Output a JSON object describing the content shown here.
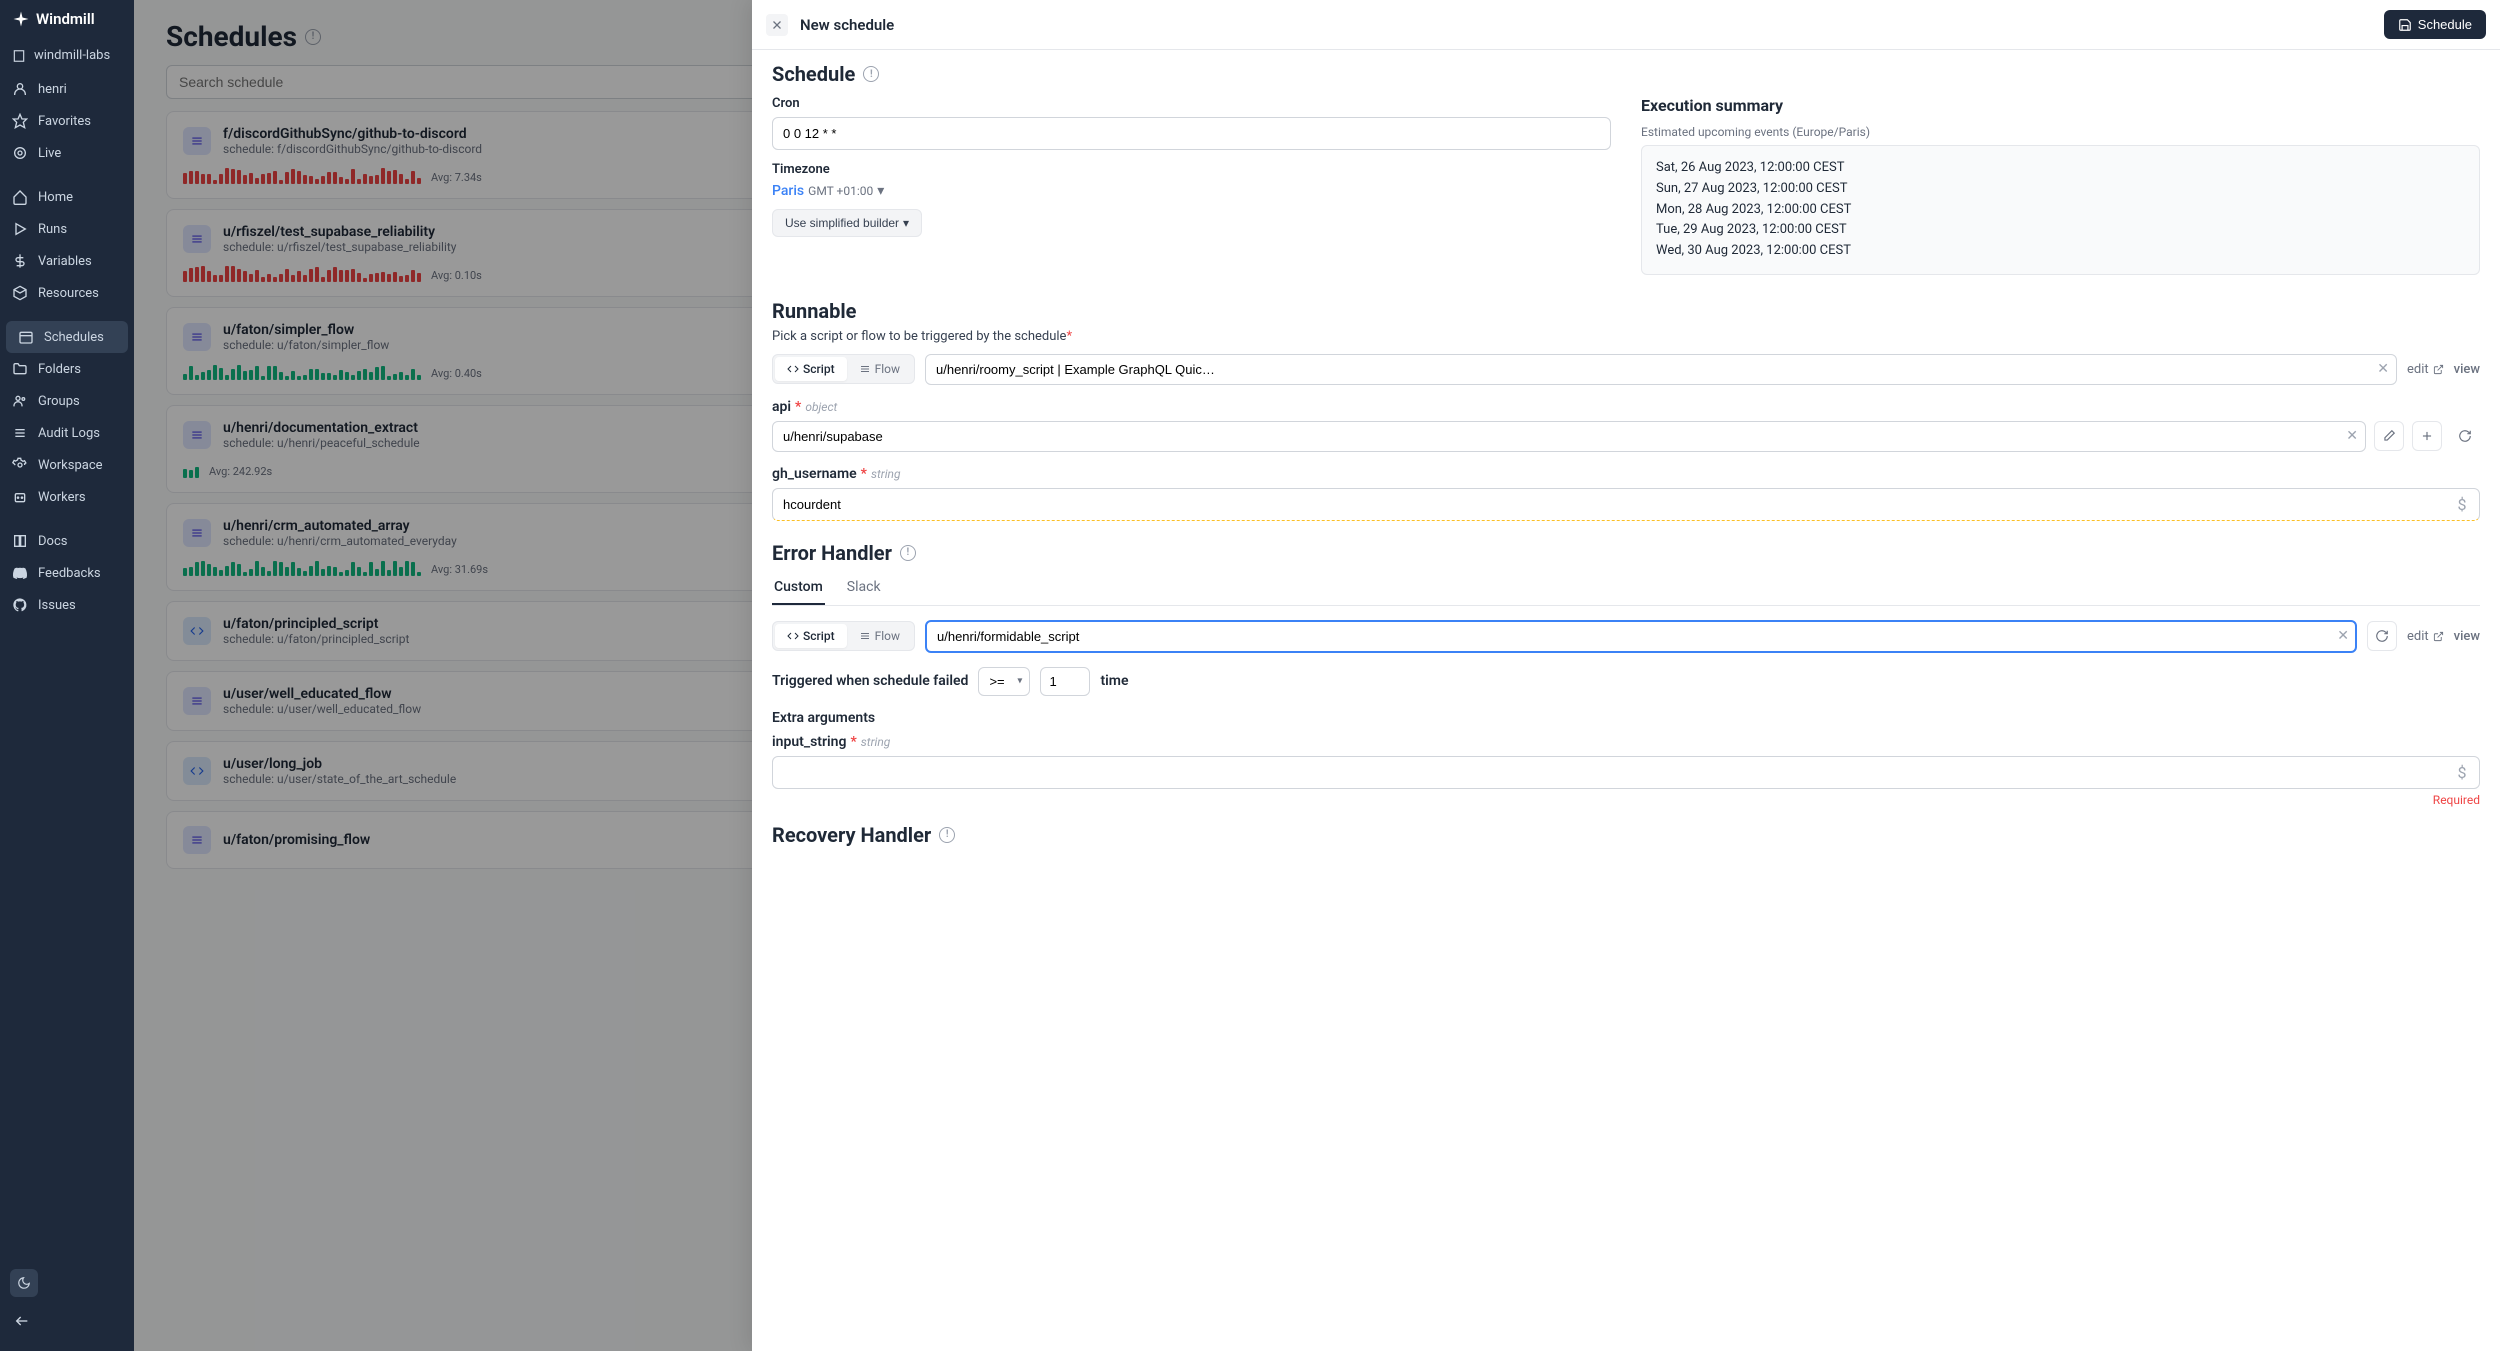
{
  "brand": "Windmill",
  "org": "windmill-labs",
  "user": "henri",
  "nav": {
    "favorites": "Favorites",
    "live": "Live",
    "home": "Home",
    "runs": "Runs",
    "variables": "Variables",
    "resources": "Resources",
    "schedules": "Schedules",
    "folders": "Folders",
    "groups": "Groups",
    "audit": "Audit Logs",
    "workspace": "Workspace",
    "workers": "Workers",
    "docs": "Docs",
    "feedbacks": "Feedbacks",
    "issues": "Issues"
  },
  "page": {
    "title": "Schedules",
    "search_placeholder": "Search schedule"
  },
  "schedules": [
    {
      "name": "f/discordGithubSync/github-to-discord",
      "sub": "schedule: f/discordGithubSync/github-to-discord",
      "avg": "Avg: 7.34s",
      "type": "flow",
      "bars": "red"
    },
    {
      "name": "u/rfiszel/test_supabase_reliability",
      "sub": "schedule: u/rfiszel/test_supabase_reliability",
      "avg": "Avg: 0.10s",
      "type": "flow",
      "bars": "red"
    },
    {
      "name": "u/faton/simpler_flow",
      "sub": "schedule: u/faton/simpler_flow",
      "avg": "Avg: 0.40s",
      "type": "flow",
      "bars": "green"
    },
    {
      "name": "u/henri/documentation_extract",
      "sub": "schedule: u/henri/peaceful_schedule",
      "avg": "Avg: 242.92s",
      "type": "flow",
      "bars": "green-short"
    },
    {
      "name": "u/henri/crm_automated_array",
      "sub": "schedule: u/henri/crm_automated_everyday",
      "avg": "Avg: 31.69s",
      "type": "flow",
      "bars": "green"
    },
    {
      "name": "u/faton/principled_script",
      "sub": "schedule: u/faton/principled_script",
      "avg": "",
      "type": "script",
      "bars": ""
    },
    {
      "name": "u/user/well_educated_flow",
      "sub": "schedule: u/user/well_educated_flow",
      "avg": "",
      "type": "flow",
      "bars": ""
    },
    {
      "name": "u/user/long_job",
      "sub": "schedule: u/user/state_of_the_art_schedule",
      "avg": "",
      "type": "script",
      "bars": ""
    },
    {
      "name": "u/faton/promising_flow",
      "sub": "",
      "avg": "",
      "type": "flow",
      "bars": ""
    }
  ],
  "drawer": {
    "title": "New schedule",
    "save_btn": "Schedule",
    "section_schedule": "Schedule",
    "cron_label": "Cron",
    "cron_value": "0 0 12 * *",
    "timezone_label": "Timezone",
    "timezone_city": "Paris",
    "timezone_offset": "GMT +01:00",
    "builder": "Use simplified builder",
    "exec_summary": "Execution summary",
    "events_label": "Estimated upcoming events (Europe/Paris)",
    "events": [
      "Sat, 26 Aug 2023, 12:00:00 CEST",
      "Sun, 27 Aug 2023, 12:00:00 CEST",
      "Mon, 28 Aug 2023, 12:00:00 CEST",
      "Tue, 29 Aug 2023, 12:00:00 CEST",
      "Wed, 30 Aug 2023, 12:00:00 CEST"
    ],
    "runnable_title": "Runnable",
    "runnable_helper": "Pick a script or flow to be triggered by the schedule",
    "toggle_script": "Script",
    "toggle_flow": "Flow",
    "runnable_value": "u/henri/roomy_script | Example GraphQL Quic…",
    "edit": "edit",
    "view": "view",
    "arg_api": "api",
    "arg_api_type": "object",
    "arg_api_value": "u/henri/supabase",
    "arg_gh": "gh_username",
    "arg_gh_type": "string",
    "arg_gh_value": "hcourdent",
    "error_handler_title": "Error Handler",
    "tab_custom": "Custom",
    "tab_slack": "Slack",
    "error_runnable": "u/henri/formidable_script",
    "trigger_label": "Triggered when schedule failed",
    "trigger_op": ">=",
    "trigger_count": "1",
    "trigger_time": "time",
    "extra_args": "Extra arguments",
    "input_string": "input_string",
    "input_string_type": "string",
    "required": "Required",
    "recovery_title": "Recovery Handler"
  }
}
